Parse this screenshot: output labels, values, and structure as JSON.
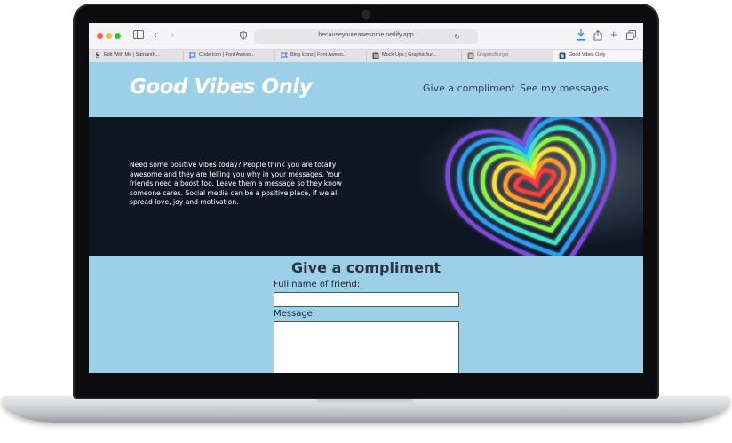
{
  "browser": {
    "url": "becauseyoureawesome.netlify.app",
    "tabs": [
      {
        "label": "Edit With Me | Samanth...",
        "favicon": "S"
      },
      {
        "label": "Code Icon | Font Aweso...",
        "favicon": "flag-icon"
      },
      {
        "label": "Blog Icons | Font Aweso...",
        "favicon": "flag-icon"
      },
      {
        "label": "Mock-Ups | GraphicBur...",
        "favicon": "burger-icon"
      },
      {
        "label": "GraphicBurger",
        "favicon": "burger-icon"
      },
      {
        "label": "Good Vibes Only",
        "favicon": "site-icon"
      }
    ]
  },
  "site": {
    "logo": "Good Vibes Only",
    "nav": [
      {
        "label": "Give a compliment"
      },
      {
        "label": "See my messages"
      }
    ],
    "hero_text": "Need some positive vibes today? People think you are totally awesome and they are telling you why in your messages. Your friends need a boost too. Leave them a message so they know someone cares. Social media can be a positive place, if we all spread love, joy and motivation.",
    "form": {
      "title": "Give a compliment",
      "name_label": "Full name of friend:",
      "message_label": "Message:"
    }
  },
  "colors": {
    "site_background": "#9bd0e8",
    "hero_background": "#0e1523",
    "heading_text": "#2c3445"
  }
}
